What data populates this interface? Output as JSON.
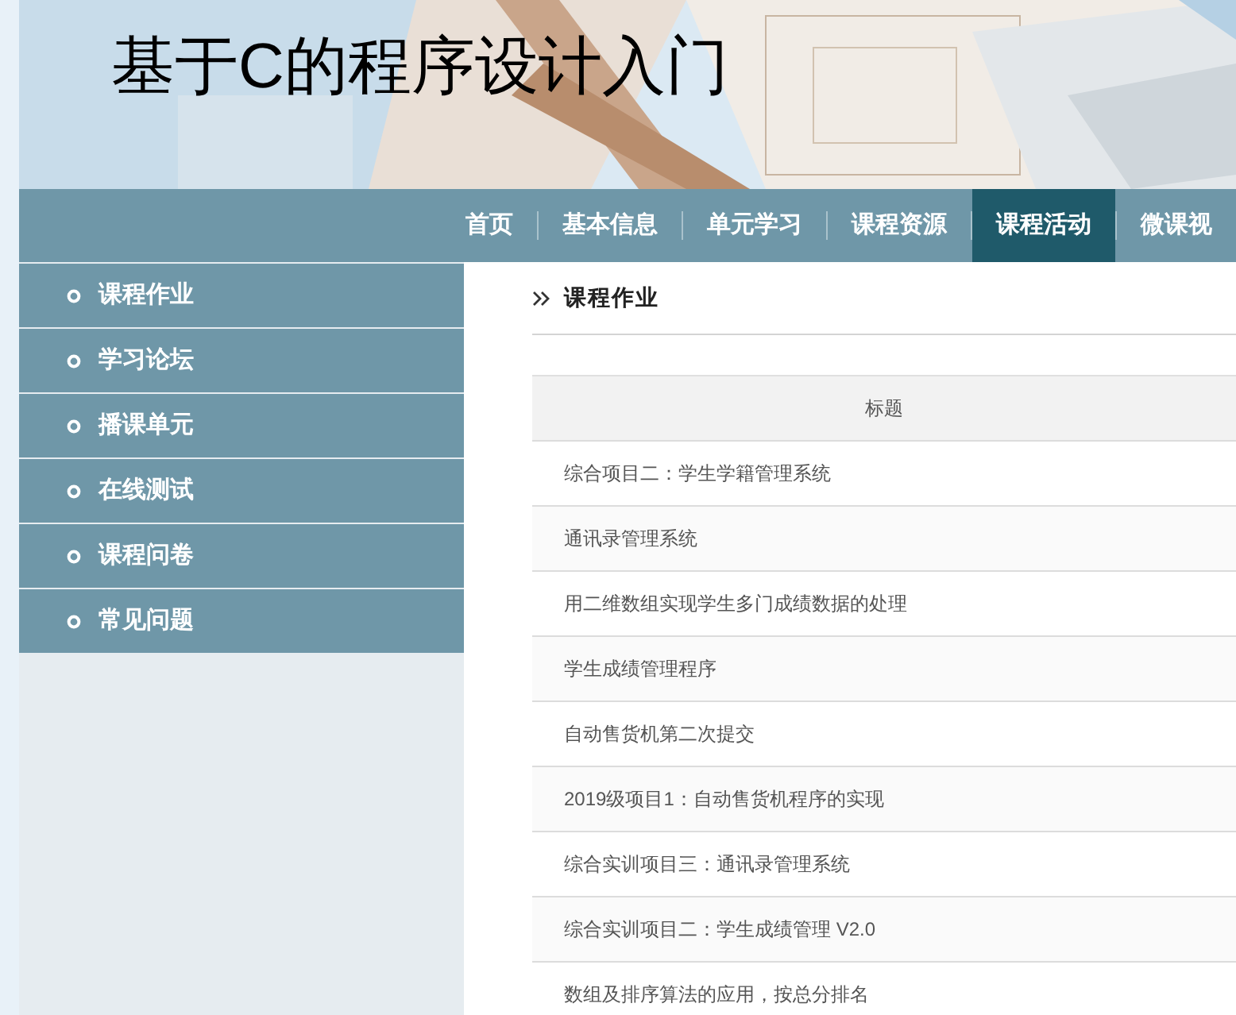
{
  "site_title": "基于C的程序设计入门",
  "nav": [
    {
      "label": "首页",
      "selected": false
    },
    {
      "label": "基本信息",
      "selected": false
    },
    {
      "label": "单元学习",
      "selected": false
    },
    {
      "label": "课程资源",
      "selected": false
    },
    {
      "label": "课程活动",
      "selected": true
    },
    {
      "label": "微课视",
      "selected": false
    }
  ],
  "sidebar": {
    "items": [
      {
        "label": "课程作业"
      },
      {
        "label": "学习论坛"
      },
      {
        "label": "播课单元"
      },
      {
        "label": "在线测试"
      },
      {
        "label": "课程问卷"
      },
      {
        "label": "常见问题"
      }
    ]
  },
  "section_title": "课程作业",
  "table": {
    "columns": [
      "标题"
    ],
    "rows": [
      [
        "综合项目二：学生学籍管理系统"
      ],
      [
        "通讯录管理系统"
      ],
      [
        "用二维数组实现学生多门成绩数据的处理"
      ],
      [
        "学生成绩管理程序"
      ],
      [
        "自动售货机第二次提交"
      ],
      [
        "2019级项目1：自动售货机程序的实现"
      ],
      [
        "综合实训项目三：通讯录管理系统"
      ],
      [
        "综合实训项目二：学生成绩管理 V2.0"
      ],
      [
        "数组及排序算法的应用，按总分排名"
      ]
    ]
  }
}
